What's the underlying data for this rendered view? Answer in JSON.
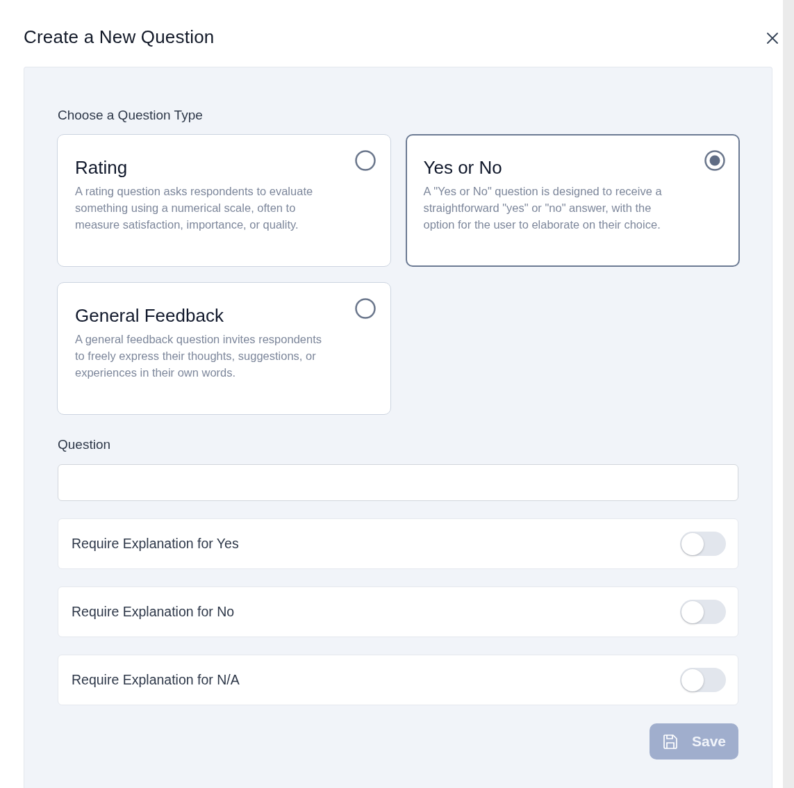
{
  "dialog": {
    "title": "Create a New Question"
  },
  "question_type": {
    "label": "Choose a Question Type",
    "options": [
      {
        "title": "Rating",
        "description": "A rating question asks respondents to evaluate something using a numerical scale, often to measure satisfaction, importance, or quality.",
        "selected": false
      },
      {
        "title": "Yes or No",
        "description": "A \"Yes or No\" question is designed to receive a straightforward \"yes\" or \"no\" answer, with the option for the user to elaborate on their choice.",
        "selected": true
      },
      {
        "title": "General Feedback",
        "description": "A general feedback question invites respondents to freely express their thoughts, suggestions, or experiences in their own words.",
        "selected": false
      }
    ]
  },
  "question": {
    "label": "Question"
  },
  "toggles": [
    {
      "label": "Require Explanation for Yes",
      "on": false
    },
    {
      "label": "Require Explanation for No",
      "on": false
    },
    {
      "label": "Require Explanation for N/A",
      "on": false
    }
  ],
  "save_button": {
    "label": "Save",
    "disabled": true
  }
}
